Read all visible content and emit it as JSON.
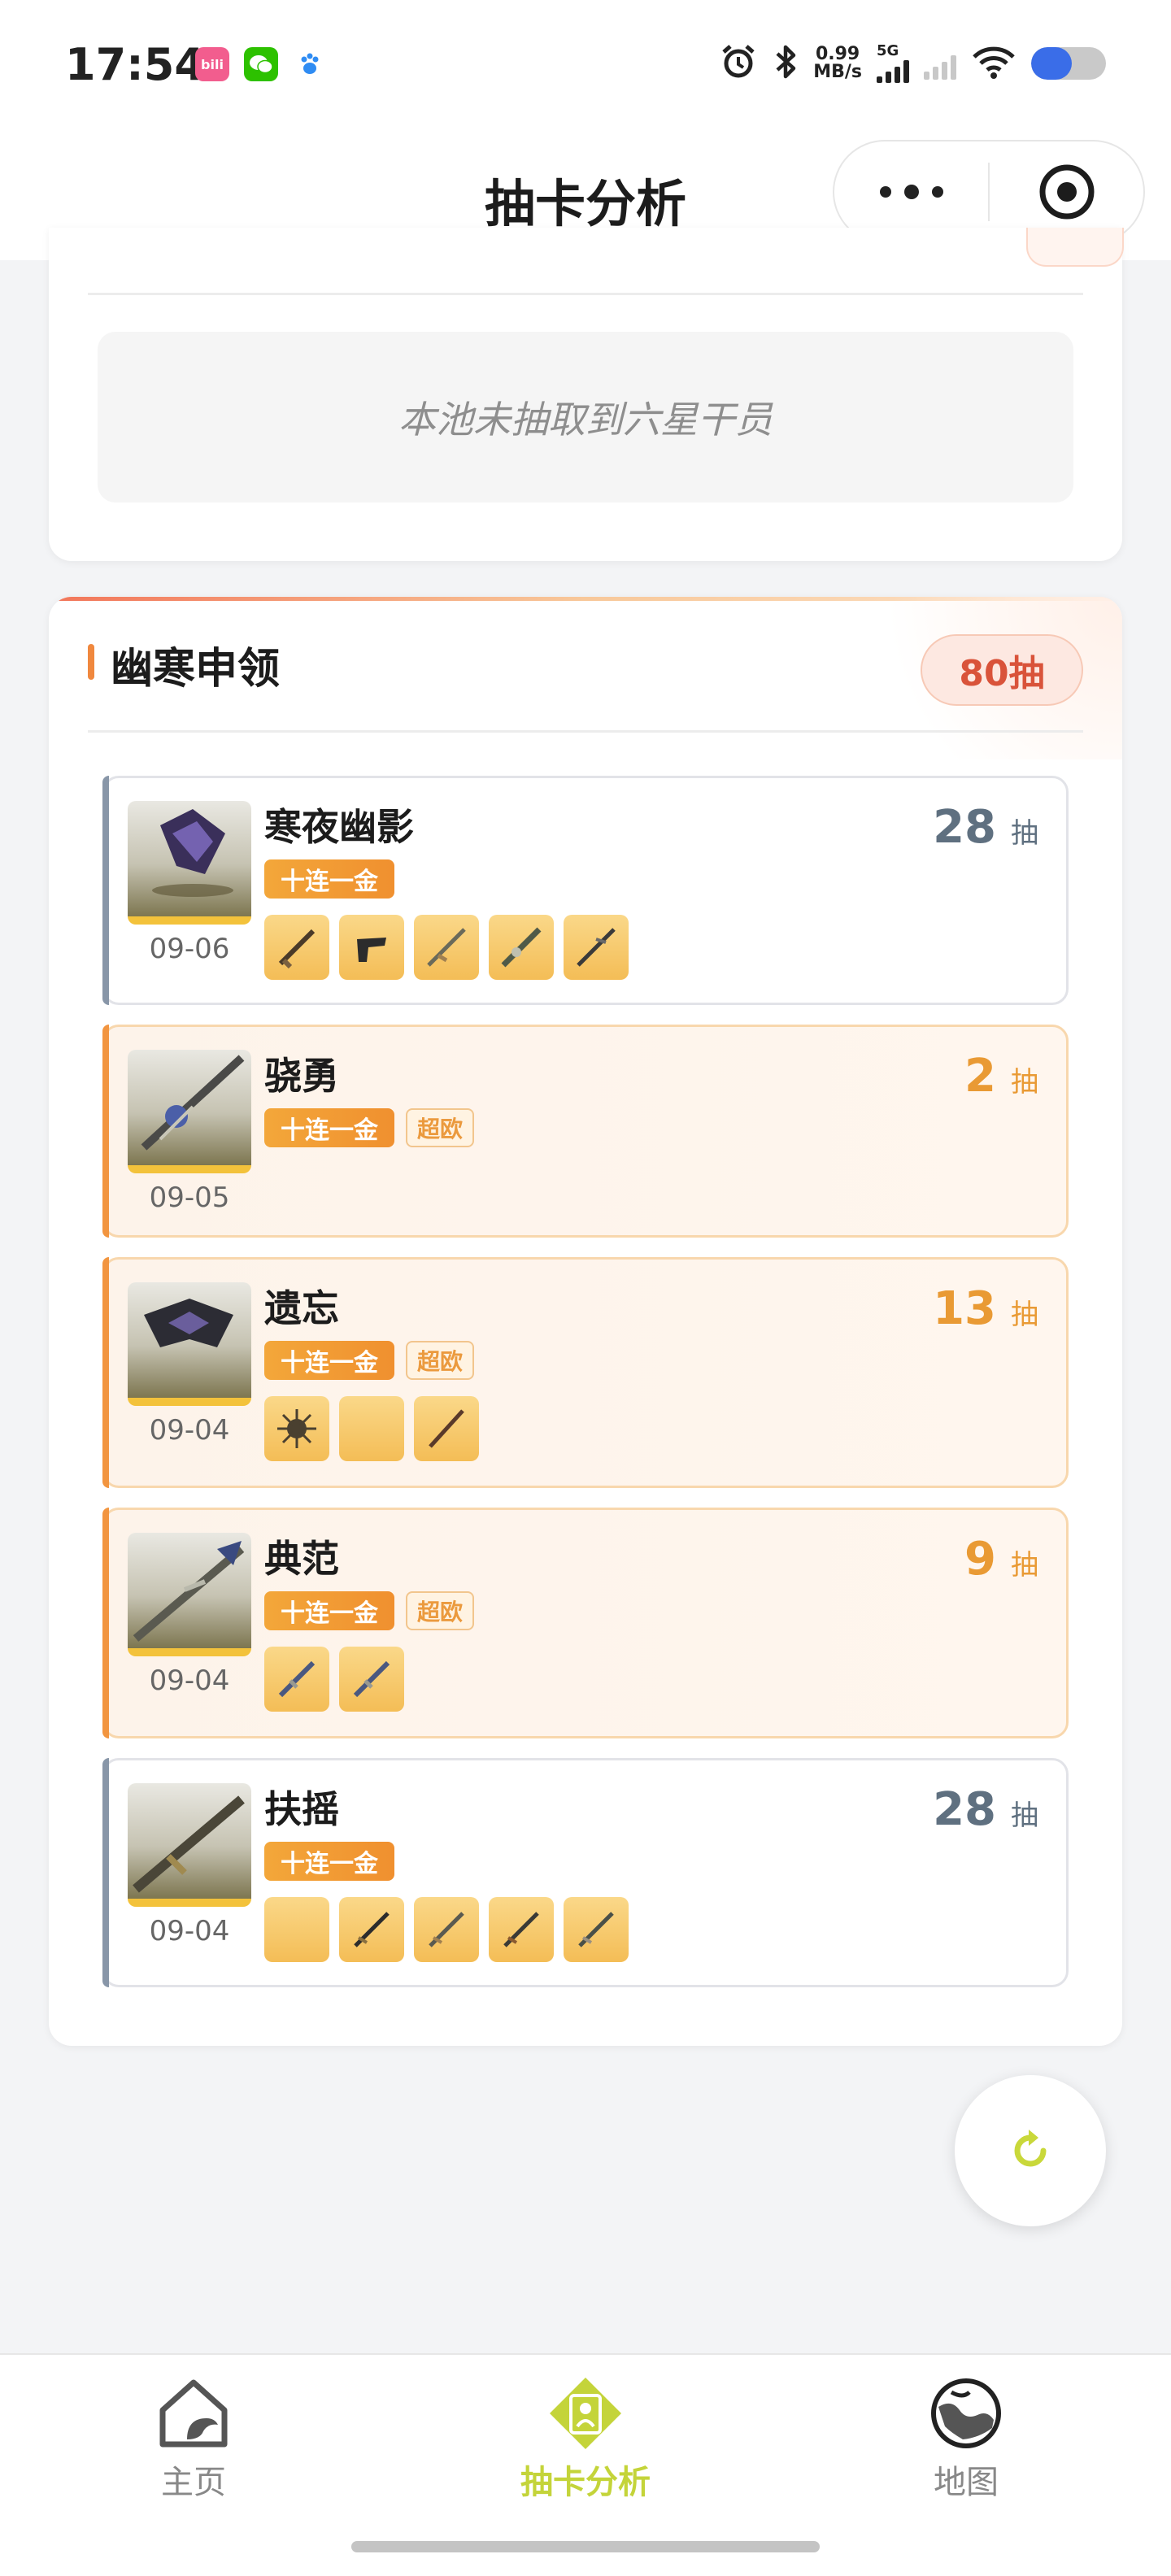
{
  "status_bar": {
    "time": "17:54",
    "apps": [
      {
        "name": "bilibili-icon",
        "label": "bili",
        "color": "#f25d8e"
      },
      {
        "name": "wechat-icon",
        "label": "",
        "color": "#2dc100"
      },
      {
        "name": "baidu-icon",
        "label": "du",
        "color": "#2f8cf3"
      }
    ],
    "speed_value": "0.99",
    "speed_unit": "MB/s",
    "network": "5G",
    "battery_level": 0.54
  },
  "nav": {
    "title": "抽卡分析"
  },
  "top_card": {
    "empty_text": "本池未抽取到六星干员"
  },
  "pool": {
    "title": "幽寒申领",
    "total_label": "80抽",
    "pulls": [
      {
        "name": "寒夜幽影",
        "date": "09-06",
        "count": "28",
        "unit": "抽",
        "tag": "十连一金",
        "lucky_tag": "",
        "lucky": false,
        "weapons": 5
      },
      {
        "name": "骁勇",
        "date": "09-05",
        "count": "2",
        "unit": "抽",
        "tag": "十连一金",
        "lucky_tag": "超欧",
        "lucky": true,
        "weapons": 0
      },
      {
        "name": "遗忘",
        "date": "09-04",
        "count": "13",
        "unit": "抽",
        "tag": "十连一金",
        "lucky_tag": "超欧",
        "lucky": true,
        "weapons": 3
      },
      {
        "name": "典范",
        "date": "09-04",
        "count": "9",
        "unit": "抽",
        "tag": "十连一金",
        "lucky_tag": "超欧",
        "lucky": true,
        "weapons": 2
      },
      {
        "name": "扶摇",
        "date": "09-04",
        "count": "28",
        "unit": "抽",
        "tag": "十连一金",
        "lucky_tag": "",
        "lucky": false,
        "weapons": 5
      }
    ]
  },
  "tabbar": {
    "tabs": [
      {
        "label": "主页",
        "icon": "home-icon",
        "active": false
      },
      {
        "label": "抽卡分析",
        "icon": "gacha-analysis-icon",
        "active": true
      },
      {
        "label": "地图",
        "icon": "map-icon",
        "active": false
      }
    ]
  },
  "colors": {
    "accent_active": "#c4d43a",
    "lucky_orange": "#e99a34",
    "badge_red": "#d9533a"
  }
}
